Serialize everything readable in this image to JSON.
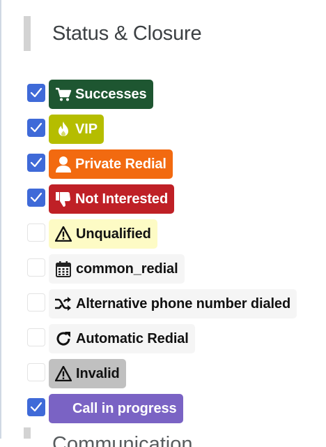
{
  "section": {
    "title": "Status & Closure",
    "next_title_fragment": "Communication channels"
  },
  "statuses": [
    {
      "label": "Successes",
      "checked": true,
      "bg": "#1e5631",
      "color": "#ffffff",
      "icon": "cart-icon"
    },
    {
      "label": "VIP",
      "checked": true,
      "bg": "#b5bd00",
      "color": "#ffffff",
      "icon": "fire-icon"
    },
    {
      "label": "Private Redial",
      "checked": true,
      "bg": "#f26a10",
      "color": "#ffffff",
      "icon": "user-icon"
    },
    {
      "label": "Not Interested",
      "checked": true,
      "bg": "#bf2026",
      "color": "#ffffff",
      "icon": "thumbs-down-icon"
    },
    {
      "label": "Unqualified",
      "checked": false,
      "bg": "#fdfbc5",
      "color": "#111111",
      "icon": "warning-icon"
    },
    {
      "label": "common_redial",
      "checked": false,
      "bg": "#f5f5f5",
      "color": "#111111",
      "icon": "calendar-icon"
    },
    {
      "label": "Alternative phone number dialed",
      "checked": false,
      "bg": "#f5f5f5",
      "color": "#111111",
      "icon": "shuffle-icon"
    },
    {
      "label": "Automatic Redial",
      "checked": false,
      "bg": "#f5f5f5",
      "color": "#111111",
      "icon": "refresh-icon"
    },
    {
      "label": "Invalid",
      "checked": false,
      "bg": "#c0c0c0",
      "color": "#111111",
      "icon": "warning-icon"
    },
    {
      "label": "Call in progress",
      "checked": true,
      "bg": "#7a63c4",
      "color": "#ffffff",
      "icon": ""
    }
  ]
}
